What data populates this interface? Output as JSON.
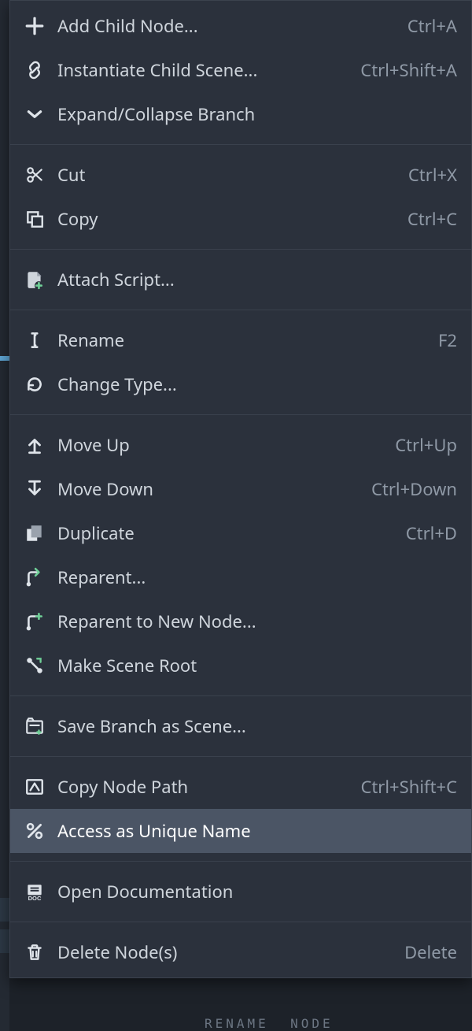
{
  "colors": {
    "menu_bg": "#2b313c",
    "hover_bg": "#4b5565",
    "text": "#cfd5dc",
    "shortcut": "#8f99a6",
    "accent_green": "#6fcf97"
  },
  "highlighted_index": 17,
  "menu": {
    "items": [
      {
        "id": "add-child-node",
        "icon": "plus-icon",
        "label": "Add Child Node...",
        "shortcut": "Ctrl+A"
      },
      {
        "id": "instantiate-scene",
        "icon": "link-icon",
        "label": "Instantiate Child Scene...",
        "shortcut": "Ctrl+Shift+A"
      },
      {
        "id": "expand-collapse",
        "icon": "chevron-down-icon",
        "label": "Expand/Collapse Branch",
        "shortcut": ""
      },
      {
        "separator": true
      },
      {
        "id": "cut",
        "icon": "scissors-icon",
        "label": "Cut",
        "shortcut": "Ctrl+X"
      },
      {
        "id": "copy",
        "icon": "copy-icon",
        "label": "Copy",
        "shortcut": "Ctrl+C"
      },
      {
        "separator": true
      },
      {
        "id": "attach-script",
        "icon": "script-plus-icon",
        "label": "Attach Script...",
        "shortcut": ""
      },
      {
        "separator": true
      },
      {
        "id": "rename",
        "icon": "text-cursor-icon",
        "label": "Rename",
        "shortcut": "F2"
      },
      {
        "id": "change-type",
        "icon": "reload-icon",
        "label": "Change Type...",
        "shortcut": ""
      },
      {
        "separator": true
      },
      {
        "id": "move-up",
        "icon": "arrow-up-icon",
        "label": "Move Up",
        "shortcut": "Ctrl+Up"
      },
      {
        "id": "move-down",
        "icon": "arrow-down-icon",
        "label": "Move Down",
        "shortcut": "Ctrl+Down"
      },
      {
        "id": "duplicate",
        "icon": "duplicate-icon",
        "label": "Duplicate",
        "shortcut": "Ctrl+D"
      },
      {
        "id": "reparent",
        "icon": "reparent-icon",
        "label": "Reparent...",
        "shortcut": ""
      },
      {
        "id": "reparent-new",
        "icon": "reparent-new-icon",
        "label": "Reparent to New Node...",
        "shortcut": ""
      },
      {
        "id": "make-scene-root",
        "icon": "scene-root-icon",
        "label": "Make Scene Root",
        "shortcut": ""
      },
      {
        "separator": true
      },
      {
        "id": "save-branch",
        "icon": "save-scene-icon",
        "label": "Save Branch as Scene...",
        "shortcut": ""
      },
      {
        "separator": true
      },
      {
        "id": "copy-node-path",
        "icon": "path-icon",
        "label": "Copy Node Path",
        "shortcut": "Ctrl+Shift+C"
      },
      {
        "id": "unique-name",
        "icon": "percent-icon",
        "label": "Access as Unique Name",
        "shortcut": ""
      },
      {
        "separator": true
      },
      {
        "id": "open-docs",
        "icon": "doc-icon",
        "label": "Open Documentation",
        "shortcut": ""
      },
      {
        "separator": true
      },
      {
        "id": "delete-nodes",
        "icon": "trash-icon",
        "label": "Delete Node(s)",
        "shortcut": "Delete"
      }
    ]
  }
}
